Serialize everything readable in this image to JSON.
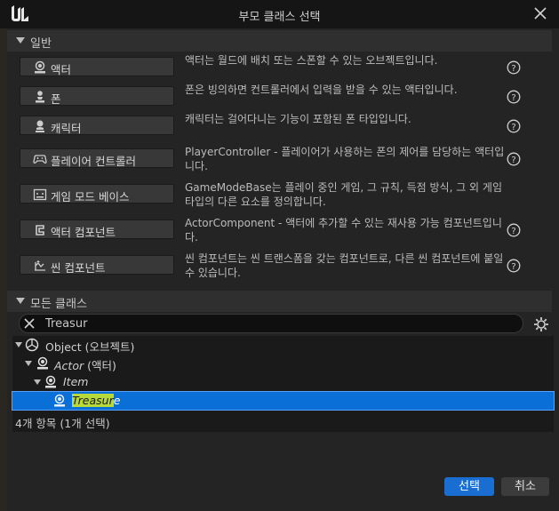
{
  "window": {
    "title": "부모 클래스 선택"
  },
  "common": {
    "header": "일반",
    "items": [
      {
        "label": "액터",
        "icon": "actor-icon",
        "desc": "액터는 월드에 배치 또는 스폰할 수 있는 오브젝트입니다."
      },
      {
        "label": "폰",
        "icon": "pawn-icon",
        "desc": "폰은 빙의하면 컨트롤러에서 입력을 받을 수 있는 액터입니다."
      },
      {
        "label": "캐릭터",
        "icon": "character-icon",
        "desc": "캐릭터는 걸어다니는 기능이 포함된 폰 타입입니다."
      },
      {
        "label": "플레이어 컨트롤러",
        "icon": "gamepad-icon",
        "desc": "PlayerController - 플레이어가 사용하는 폰의 제어를 담당하는 액터입니다."
      },
      {
        "label": "게임 모드 베이스",
        "icon": "game-mode-icon",
        "desc": "GameModeBase는 플레이 중인 게임, 그 규칙, 득점 방식, 그 외 게임 타입의 다른 요소를 정의합니다."
      },
      {
        "label": "액터 컴포넌트",
        "icon": "component-icon",
        "desc": "ActorComponent - 액터에 추가할 수 있는 재사용 가능 컴포넌트입니다."
      },
      {
        "label": "씬 컴포넌트",
        "icon": "scene-component-icon",
        "desc": "씬 컴포넌트는 씬 트랜스폼을 갖는 컴포넌트로, 다른 씬 컴포넌트에 붙일 수 있습니다."
      }
    ]
  },
  "all_classes": {
    "header": "모든 클래스",
    "search_value": "Treasur",
    "tree": [
      {
        "label": "Object (오브젝트)",
        "italic": false,
        "icon": "object-icon",
        "expanded": true
      },
      {
        "label": "Actor (액터)",
        "italic": true,
        "label_main": "Actor",
        "label_extra": " (액터)",
        "icon": "actor-icon",
        "expanded": true
      },
      {
        "label": "Item",
        "italic": true,
        "icon": "actor-icon",
        "expanded": true
      },
      {
        "label": "Treasure",
        "match": "Treasur",
        "rest": "e",
        "icon": "actor-icon",
        "selected": true
      }
    ],
    "status": "4개 항목 (1개 선택)"
  },
  "buttons": {
    "select": "선택",
    "cancel": "취소"
  },
  "colors": {
    "selection": "#0a6fd6",
    "primary_button": "#1a6ed1",
    "match_highlight": "#b8d93a"
  }
}
